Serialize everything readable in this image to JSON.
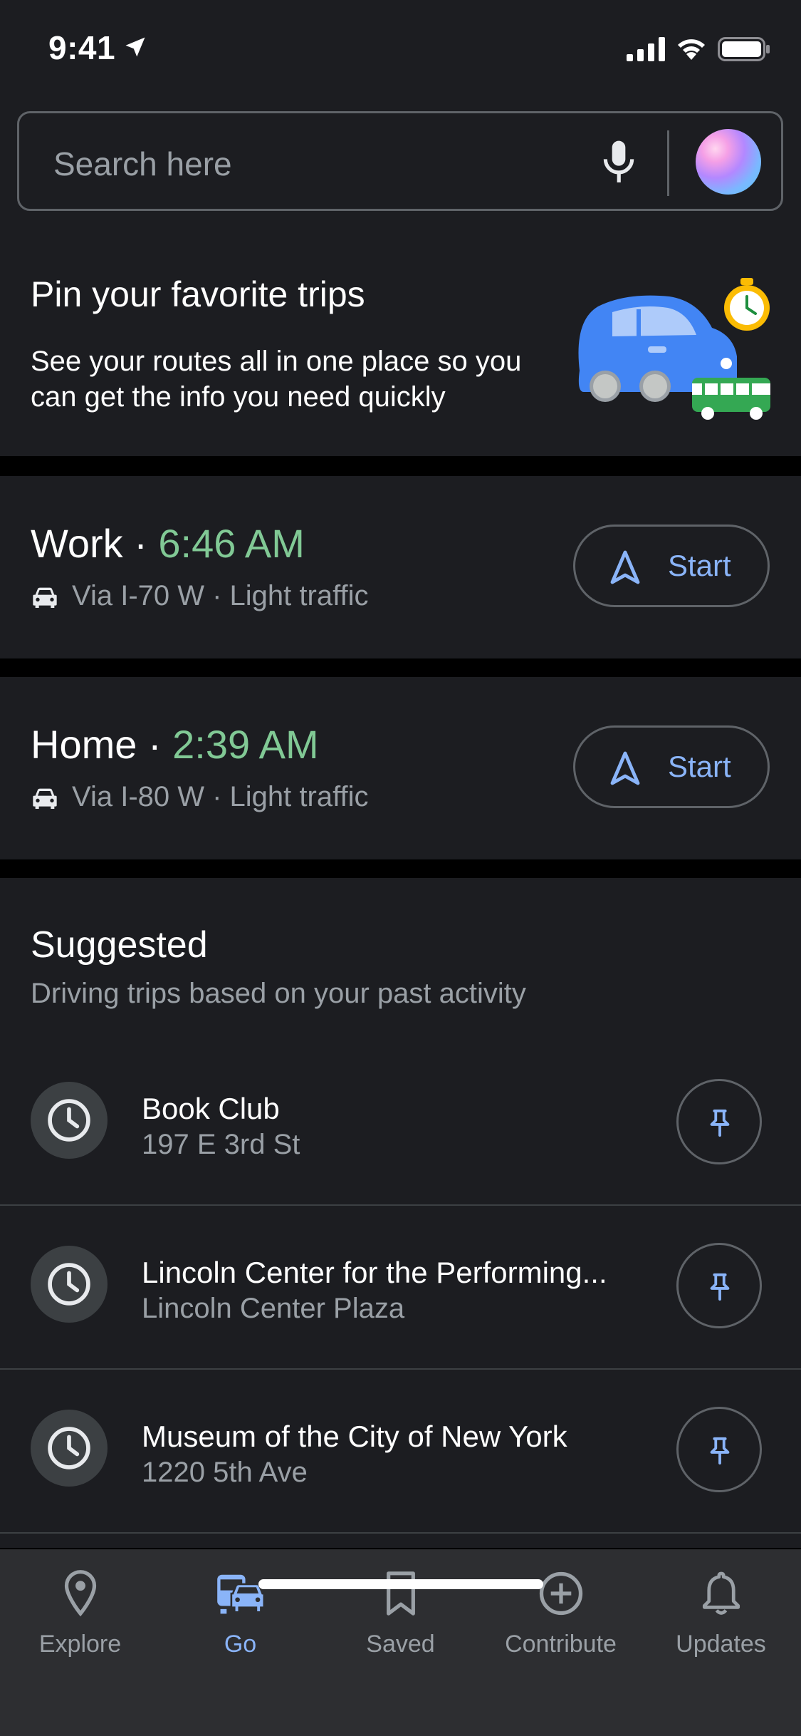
{
  "status_bar": {
    "time": "9:41"
  },
  "search": {
    "placeholder": "Search here"
  },
  "promo": {
    "title": "Pin your favorite trips",
    "body": "See your routes all in one place so you can get the info you need quickly"
  },
  "pinned_trips": [
    {
      "name": "Work",
      "separator": " · ",
      "time": "6:46 AM",
      "route": "Via I-70 W · Light traffic",
      "start_label": "Start"
    },
    {
      "name": "Home",
      "separator": " · ",
      "time": "2:39 AM",
      "route": "Via I-80 W · Light traffic",
      "start_label": "Start"
    }
  ],
  "suggested": {
    "title": "Suggested",
    "subtitle": "Driving trips based on your past activity",
    "items": [
      {
        "name": "Book Club",
        "address": "197 E 3rd St"
      },
      {
        "name": "Lincoln Center for the Performing...",
        "address": "Lincoln Center Plaza"
      },
      {
        "name": "Museum of the City of New York",
        "address": "1220 5th Ave"
      }
    ]
  },
  "bottom_nav": {
    "active": "Go",
    "items": [
      {
        "label": "Explore",
        "icon": "location-pin-icon"
      },
      {
        "label": "Go",
        "icon": "car-bus-icon"
      },
      {
        "label": "Saved",
        "icon": "bookmark-icon"
      },
      {
        "label": "Contribute",
        "icon": "add-circle-icon"
      },
      {
        "label": "Updates",
        "icon": "bell-icon"
      }
    ]
  },
  "colors": {
    "background": "#1c1d21",
    "accent_blue": "#8ab4f8",
    "time_green": "#81c995",
    "secondary_text": "#9aa0a6"
  }
}
